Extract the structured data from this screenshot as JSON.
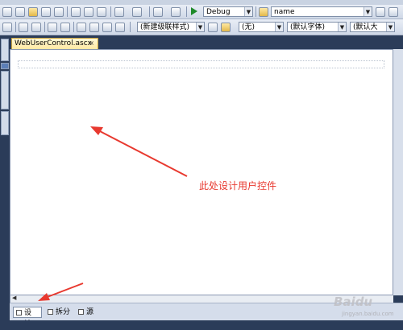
{
  "toolbar": {
    "config_value": "Debug",
    "find_value": "name",
    "style_value": "(新建级联样式)",
    "block_format_value": "(无)",
    "font_value": "(默认字体)",
    "size_value": "(默认大"
  },
  "document_tab": {
    "title": "WebUserControl.ascx",
    "close_glyph": "×"
  },
  "annotation": {
    "text": "此处设计用户控件",
    "color": "#e8392f"
  },
  "view_buttons": [
    {
      "label": "设计",
      "active": true
    },
    {
      "label": "拆分",
      "active": false
    },
    {
      "label": "源",
      "active": false
    }
  ],
  "watermark": {
    "text": "Baidu",
    "sub": "jingyan.baidu.com"
  },
  "icons": [
    "start-debug-icon",
    "new-project-icon",
    "open-icon",
    "save-icon",
    "cut-icon",
    "copy-icon",
    "paste-icon",
    "undo-icon",
    "redo-icon",
    "find-icon",
    "close-tab-icon",
    "view-design-icon",
    "view-split-icon",
    "view-source-icon"
  ]
}
